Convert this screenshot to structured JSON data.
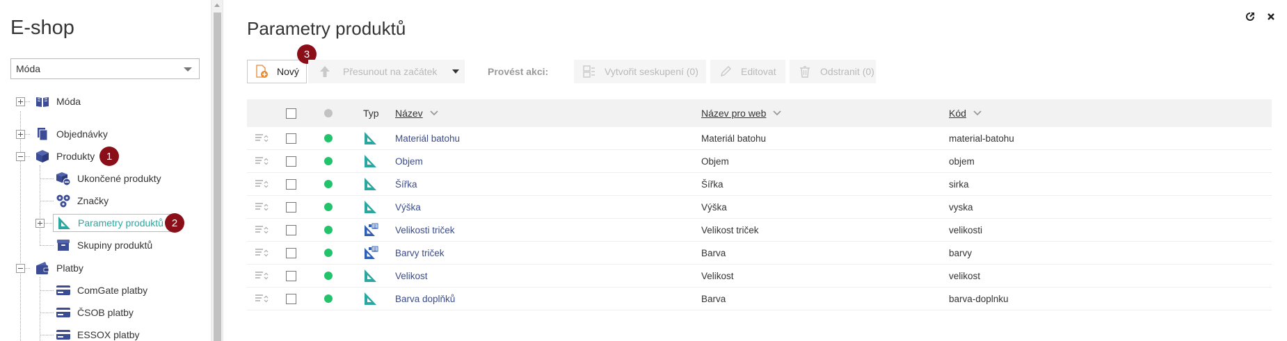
{
  "sidebar": {
    "title": "E-shop",
    "select_value": "Móda",
    "tree": {
      "root": "Móda",
      "orders": "Objednávky",
      "products": "Produkty",
      "products_children": [
        "Ukončené produkty",
        "Značky",
        "Parametry produktů",
        "Skupiny produktů"
      ],
      "payments": "Platby",
      "payments_children": [
        "ComGate platby",
        "ČSOB platby",
        "ESSOX platby"
      ]
    },
    "badges": [
      "1",
      "2"
    ]
  },
  "main": {
    "title": "Parametry produktů",
    "toolbar": {
      "new_label": "Nový",
      "new_badge": "3",
      "move_label": "Přesunout na začátek",
      "actions_label": "Provést akci:",
      "group_label": "Vytvořit seskupení (0)",
      "edit_label": "Editovat",
      "delete_label": "Odstranit (0)"
    },
    "table": {
      "headers": {
        "type": "Typ",
        "name": "Název",
        "web_name": "Název pro web",
        "code": "Kód"
      },
      "rows": [
        {
          "name": "Materiál batohu",
          "web_name": "Materiál batohu",
          "code": "material-batohu",
          "type": "param"
        },
        {
          "name": "Objem",
          "web_name": "Objem",
          "code": "objem",
          "type": "param"
        },
        {
          "name": "Šířka",
          "web_name": "Šířka",
          "code": "sirka",
          "type": "param"
        },
        {
          "name": "Výška",
          "web_name": "Výška",
          "code": "vyska",
          "type": "param"
        },
        {
          "name": "Velikosti triček",
          "web_name": "Velikost triček",
          "code": "velikosti",
          "type": "list"
        },
        {
          "name": "Barvy triček",
          "web_name": "Barva",
          "code": "barvy",
          "type": "list"
        },
        {
          "name": "Velikost",
          "web_name": "Velikost",
          "code": "velikost",
          "type": "param"
        },
        {
          "name": "Barva doplňků",
          "web_name": "Barva",
          "code": "barva-doplnku",
          "type": "param"
        }
      ]
    }
  },
  "colors": {
    "accent_teal": "#2aa7a0",
    "badge": "#8b0f18",
    "active_dot": "#22c36a",
    "link": "#3a4c8c"
  }
}
